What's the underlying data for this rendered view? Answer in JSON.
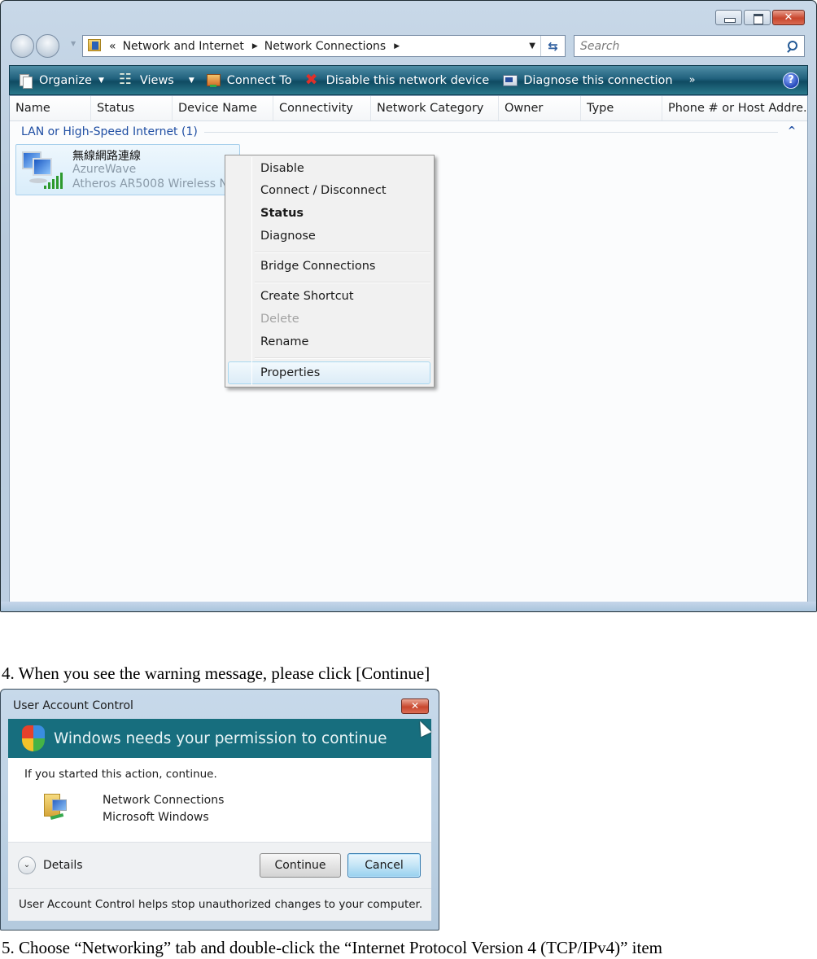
{
  "explorer": {
    "title_buttons": {
      "minimize": "minimize",
      "maximize": "maximize",
      "close": "✕"
    },
    "address": {
      "overflow": "«",
      "crumbs": [
        "Network and Internet",
        "Network Connections"
      ],
      "separator": "▶",
      "dropdown": "▼",
      "refresh": "⇆"
    },
    "search": {
      "placeholder": "Search"
    },
    "command_bar": {
      "organize": "Organize",
      "views": "Views",
      "connect_to": "Connect To",
      "disable": "Disable this network device",
      "diagnose": "Diagnose this connection",
      "more": "»",
      "help": "?",
      "caret": "▼"
    },
    "columns": [
      "Name",
      "Status",
      "Device Name",
      "Connectivity",
      "Network Category",
      "Owner",
      "Type",
      "Phone # or Host Addre..."
    ],
    "group": {
      "label": "LAN or High-Speed Internet (1)",
      "collapse": "^"
    },
    "connection": {
      "name": "無線網路連線",
      "network": "AzureWave",
      "device": "Atheros AR5008 Wireless Ne..."
    },
    "context_menu": {
      "items": [
        {
          "label": "Disable"
        },
        {
          "label": "Connect / Disconnect"
        },
        {
          "label": "Status",
          "bold": true
        },
        {
          "label": "Diagnose"
        },
        {
          "label": "Bridge Connections"
        },
        {
          "label": "Create Shortcut"
        },
        {
          "label": "Delete",
          "disabled": true
        },
        {
          "label": "Rename"
        },
        {
          "label": "Properties",
          "highlighted": true
        }
      ]
    }
  },
  "doc": {
    "step4": "4. When you see the warning message, please click [Continue]",
    "step5": "5. Choose “Networking” tab and double-click the “Internet Protocol Version 4 (TCP/IPv4)” item"
  },
  "uac": {
    "title": "User Account Control",
    "close": "✕",
    "banner": "Windows needs your permission to continue",
    "lead": "If you started this action, continue.",
    "app_name": "Network Connections",
    "publisher": "Microsoft Windows",
    "details": "Details",
    "details_chevron": "⌄",
    "continue": "Continue",
    "cancel": "Cancel",
    "footer": "User Account Control helps stop unauthorized changes to your computer."
  }
}
